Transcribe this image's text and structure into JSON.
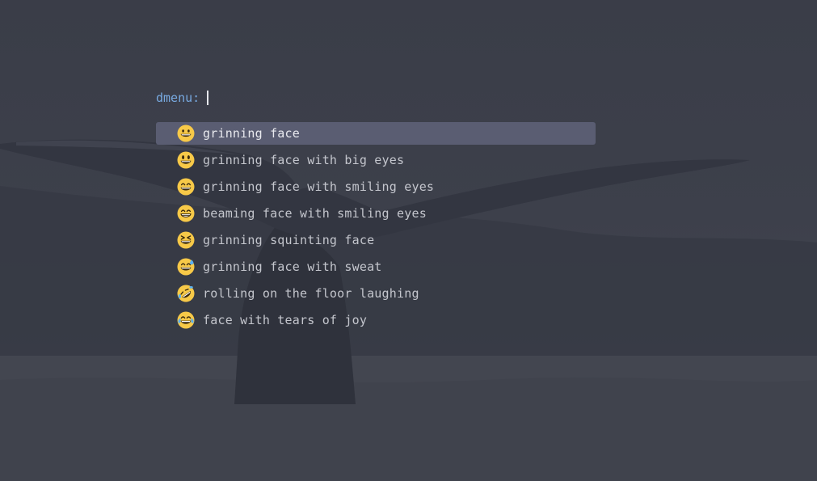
{
  "prompt": {
    "label": "dmenu:",
    "value": ""
  },
  "items": [
    {
      "icon": "grinning-face-icon",
      "label": "grinning face",
      "selected": true
    },
    {
      "icon": "grinning-face-with-big-eyes-icon",
      "label": "grinning face with big eyes",
      "selected": false
    },
    {
      "icon": "grinning-face-with-smiling-eyes-icon",
      "label": "grinning face with smiling eyes",
      "selected": false
    },
    {
      "icon": "beaming-face-with-smiling-eyes-icon",
      "label": "beaming face with smiling eyes",
      "selected": false
    },
    {
      "icon": "grinning-squinting-face-icon",
      "label": "grinning squinting face",
      "selected": false
    },
    {
      "icon": "grinning-face-with-sweat-icon",
      "label": "grinning face with sweat",
      "selected": false
    },
    {
      "icon": "rolling-on-the-floor-laughing-icon",
      "label": "rolling on the floor laughing",
      "selected": false
    },
    {
      "icon": "face-with-tears-of-joy-icon",
      "label": "face with tears of joy",
      "selected": false
    }
  ],
  "colors": {
    "background": "#3c3f4b",
    "prompt_label": "#78a9e0",
    "selection": "#5a5d72",
    "text": "#c4c6cd",
    "emoji_face": "#f7c948"
  }
}
